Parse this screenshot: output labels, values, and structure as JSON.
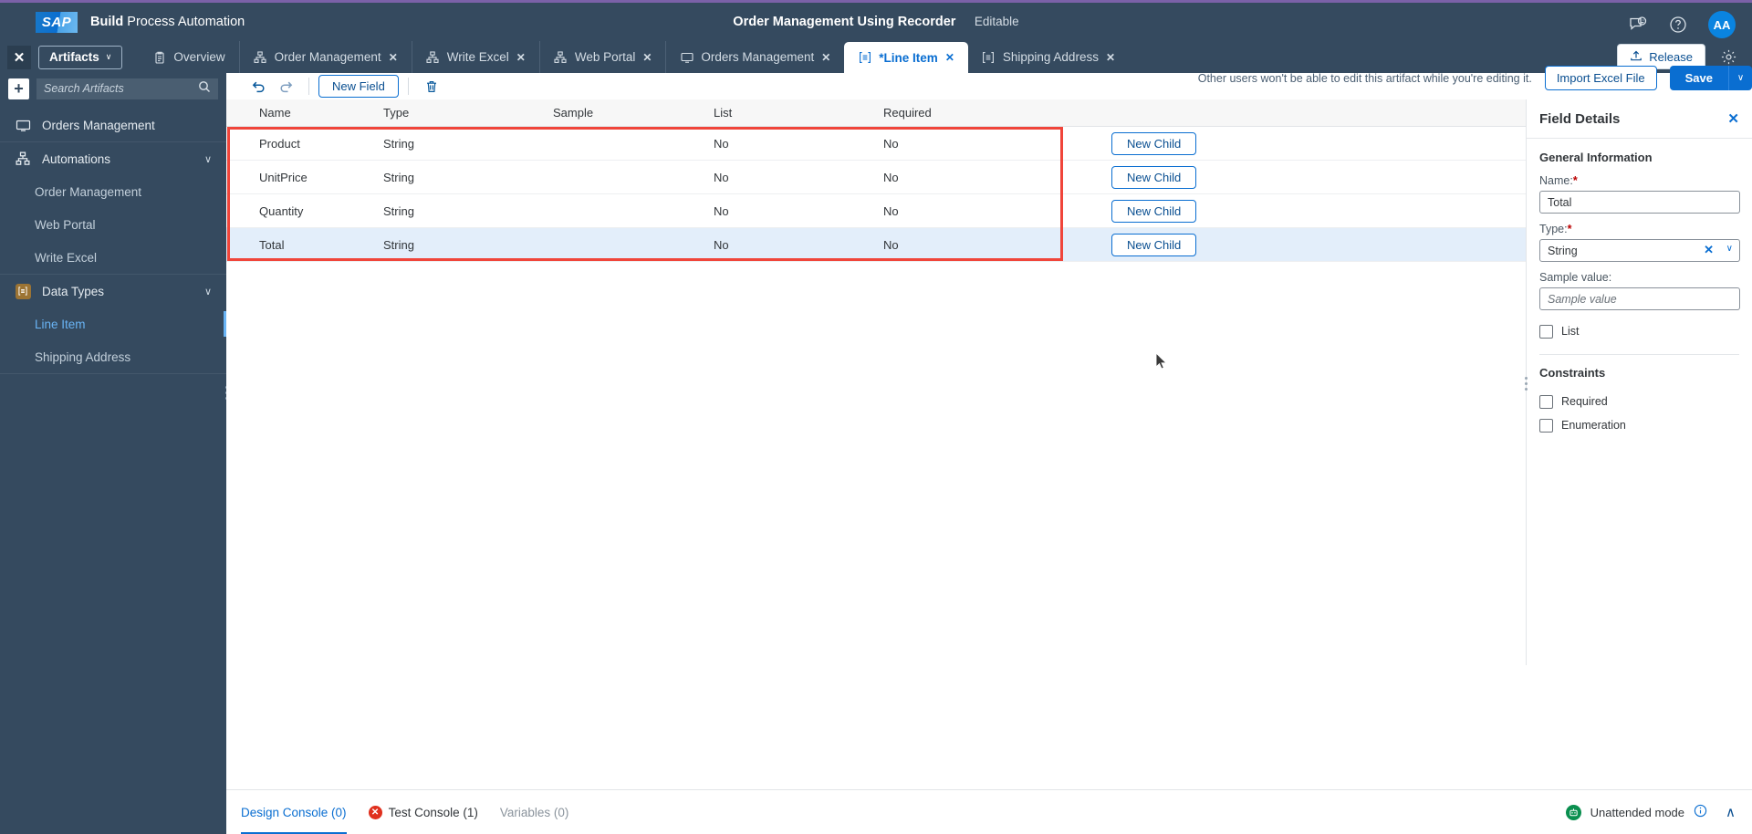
{
  "shell": {
    "logo_text": "SAP",
    "product_bold": "Build",
    "product_rest": " Process Automation",
    "artifact_title": "Order Management Using Recorder",
    "artifact_state": "Editable",
    "feedback_icon": "feedback-icon",
    "help_icon": "help-icon",
    "avatar_initials": "AA"
  },
  "tabbar": {
    "close_label": "✕",
    "artifacts_label": "Artifacts",
    "artifacts_caret": "∨",
    "release_label": "Release",
    "settings_icon": "gear-icon",
    "tabs": [
      {
        "label": "Overview",
        "icon": "overview-icon",
        "closable": false,
        "active": false
      },
      {
        "label": "Order Management",
        "icon": "automation-icon",
        "closable": true,
        "active": false
      },
      {
        "label": "Write Excel",
        "icon": "automation-icon",
        "closable": true,
        "active": false
      },
      {
        "label": "Web Portal",
        "icon": "automation-icon",
        "closable": true,
        "active": false
      },
      {
        "label": "Orders Management",
        "icon": "screen-icon",
        "closable": true,
        "active": false
      },
      {
        "label": "*Line Item",
        "icon": "datatype-icon",
        "closable": true,
        "active": true
      },
      {
        "label": "Shipping Address",
        "icon": "datatype-icon",
        "closable": true,
        "active": false
      }
    ],
    "tab_close_glyph": "✕"
  },
  "sidebar": {
    "add_label": "+",
    "search_placeholder": "Search Artifacts",
    "search_value": "",
    "search_icon": "search-icon",
    "project": {
      "label": "Orders Management",
      "icon": "project-icon"
    },
    "groups": [
      {
        "label": "Automations",
        "icon": "automation-icon",
        "caret": "∨",
        "children": [
          {
            "label": "Order Management",
            "selected": false
          },
          {
            "label": "Web Portal",
            "selected": false
          },
          {
            "label": "Write Excel",
            "selected": false
          }
        ]
      },
      {
        "label": "Data Types",
        "icon": "datatype-icon",
        "caret": "∨",
        "children": [
          {
            "label": "Line Item",
            "selected": true
          },
          {
            "label": "Shipping Address",
            "selected": false
          }
        ]
      }
    ]
  },
  "editor": {
    "toolbar": {
      "undo_icon": "undo-icon",
      "redo_icon": "redo-icon",
      "new_field_label": "New Field",
      "delete_icon": "trash-icon",
      "lock_note": "Other users won't be able to edit this artifact while you're editing it.",
      "import_label": "Import Excel File",
      "save_label": "Save",
      "save_caret": "∨"
    },
    "table": {
      "columns": [
        "Name",
        "Type",
        "Sample",
        "List",
        "Required"
      ],
      "action_label": "New Child",
      "rows": [
        {
          "name": "Product",
          "type": "String",
          "sample": "",
          "list": "No",
          "required": "No",
          "selected": false
        },
        {
          "name": "UnitPrice",
          "type": "String",
          "sample": "",
          "list": "No",
          "required": "No",
          "selected": false
        },
        {
          "name": "Quantity",
          "type": "String",
          "sample": "",
          "list": "No",
          "required": "No",
          "selected": false
        },
        {
          "name": "Total",
          "type": "String",
          "sample": "",
          "list": "No",
          "required": "No",
          "selected": true
        }
      ]
    },
    "highlight_color": "#f0453a"
  },
  "field_details": {
    "title": "Field Details",
    "close_glyph": "✕",
    "general_section": "General Information",
    "name_label": "Name:",
    "name_value": "Total",
    "type_label": "Type:",
    "type_value": "String",
    "type_clear_glyph": "✕",
    "type_caret": "∨",
    "sample_label": "Sample value:",
    "sample_value": "",
    "sample_placeholder": "Sample value",
    "list_label": "List",
    "list_checked": false,
    "constraints_section": "Constraints",
    "required_label": "Required",
    "required_checked": false,
    "enumeration_label": "Enumeration",
    "enumeration_checked": false,
    "required_marker": "*"
  },
  "console": {
    "tabs": [
      {
        "label": "Design Console (0)",
        "active": true,
        "error": false,
        "muted": false
      },
      {
        "label": "Test Console (1)",
        "active": false,
        "error": true,
        "muted": false
      },
      {
        "label": "Variables (0)",
        "active": false,
        "error": false,
        "muted": true
      }
    ],
    "error_glyph": "✕",
    "mode_label": "Unattended mode",
    "mode_icon": "robot-icon",
    "info_icon": "info-icon",
    "collapse_caret": "∧"
  }
}
